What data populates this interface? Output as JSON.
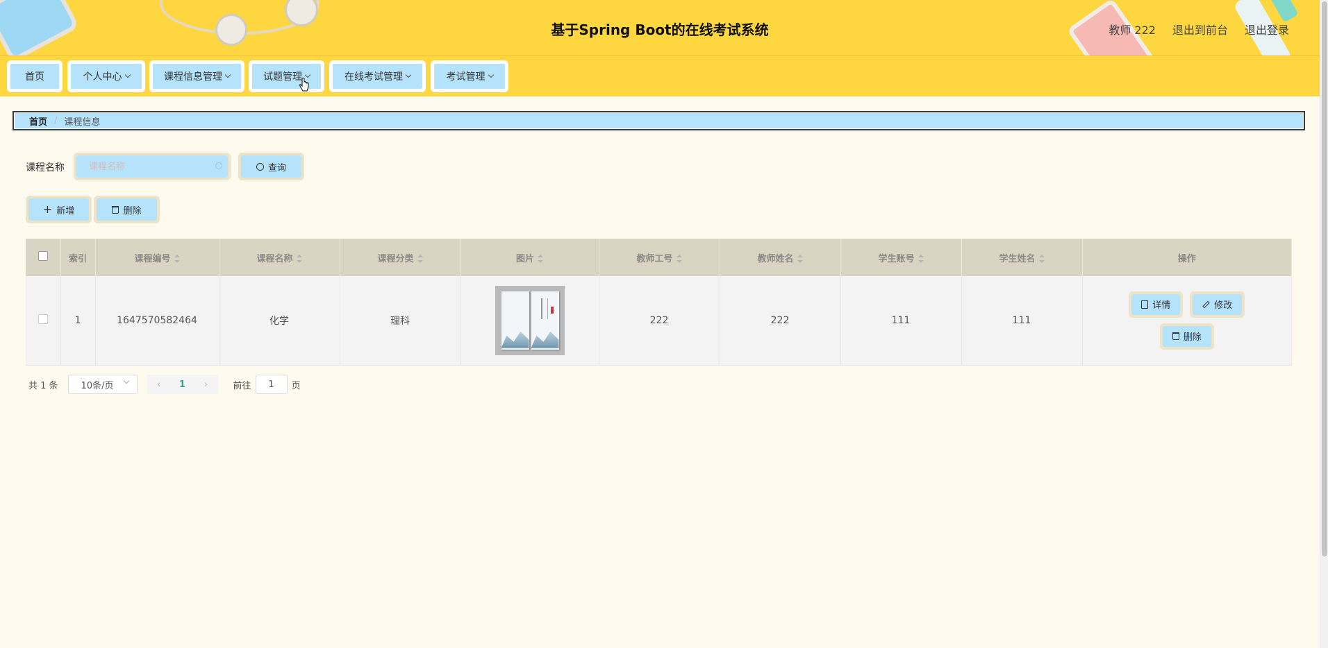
{
  "header": {
    "title": "基于Spring Boot的在线考试系统",
    "user": "教师 222",
    "to_front": "退出到前台",
    "logout": "退出登录"
  },
  "nav": [
    {
      "label": "首页",
      "has_dropdown": false
    },
    {
      "label": "个人中心",
      "has_dropdown": true
    },
    {
      "label": "课程信息管理",
      "has_dropdown": true
    },
    {
      "label": "试题管理",
      "has_dropdown": true
    },
    {
      "label": "在线考试管理",
      "has_dropdown": true
    },
    {
      "label": "考试管理",
      "has_dropdown": true
    }
  ],
  "breadcrumb": {
    "home": "首页",
    "separator": "/",
    "current": "课程信息"
  },
  "search": {
    "label": "课程名称",
    "placeholder": "课程名称",
    "value": "",
    "button": "查询"
  },
  "actions": {
    "add": "新增",
    "delete": "删除"
  },
  "table": {
    "headers": {
      "index": "索引",
      "course_no": "课程编号",
      "course_name": "课程名称",
      "category": "课程分类",
      "image": "图片",
      "teacher_no": "教师工号",
      "teacher_name": "教师姓名",
      "student_account": "学生账号",
      "student_name": "学生姓名",
      "ops": "操作"
    },
    "rows": [
      {
        "index": "1",
        "course_no": "1647570582464",
        "course_name": "化学",
        "category": "理科",
        "teacher_no": "222",
        "teacher_name": "222",
        "student_account": "111",
        "student_name": "111"
      }
    ],
    "row_actions": {
      "detail": "详情",
      "edit": "修改",
      "delete": "删除"
    }
  },
  "pager": {
    "total": "共 1 条",
    "page_size": "10条/页",
    "current_page": "1",
    "goto_prefix": "前往",
    "goto_value": "1",
    "goto_suffix": "页"
  },
  "colors": {
    "header_bg": "#fdd640",
    "button_bg": "#b5e3fb",
    "page_bg": "#fefaee",
    "table_head_bg": "#d9d5c2",
    "pager_active": "#2fa98c"
  }
}
